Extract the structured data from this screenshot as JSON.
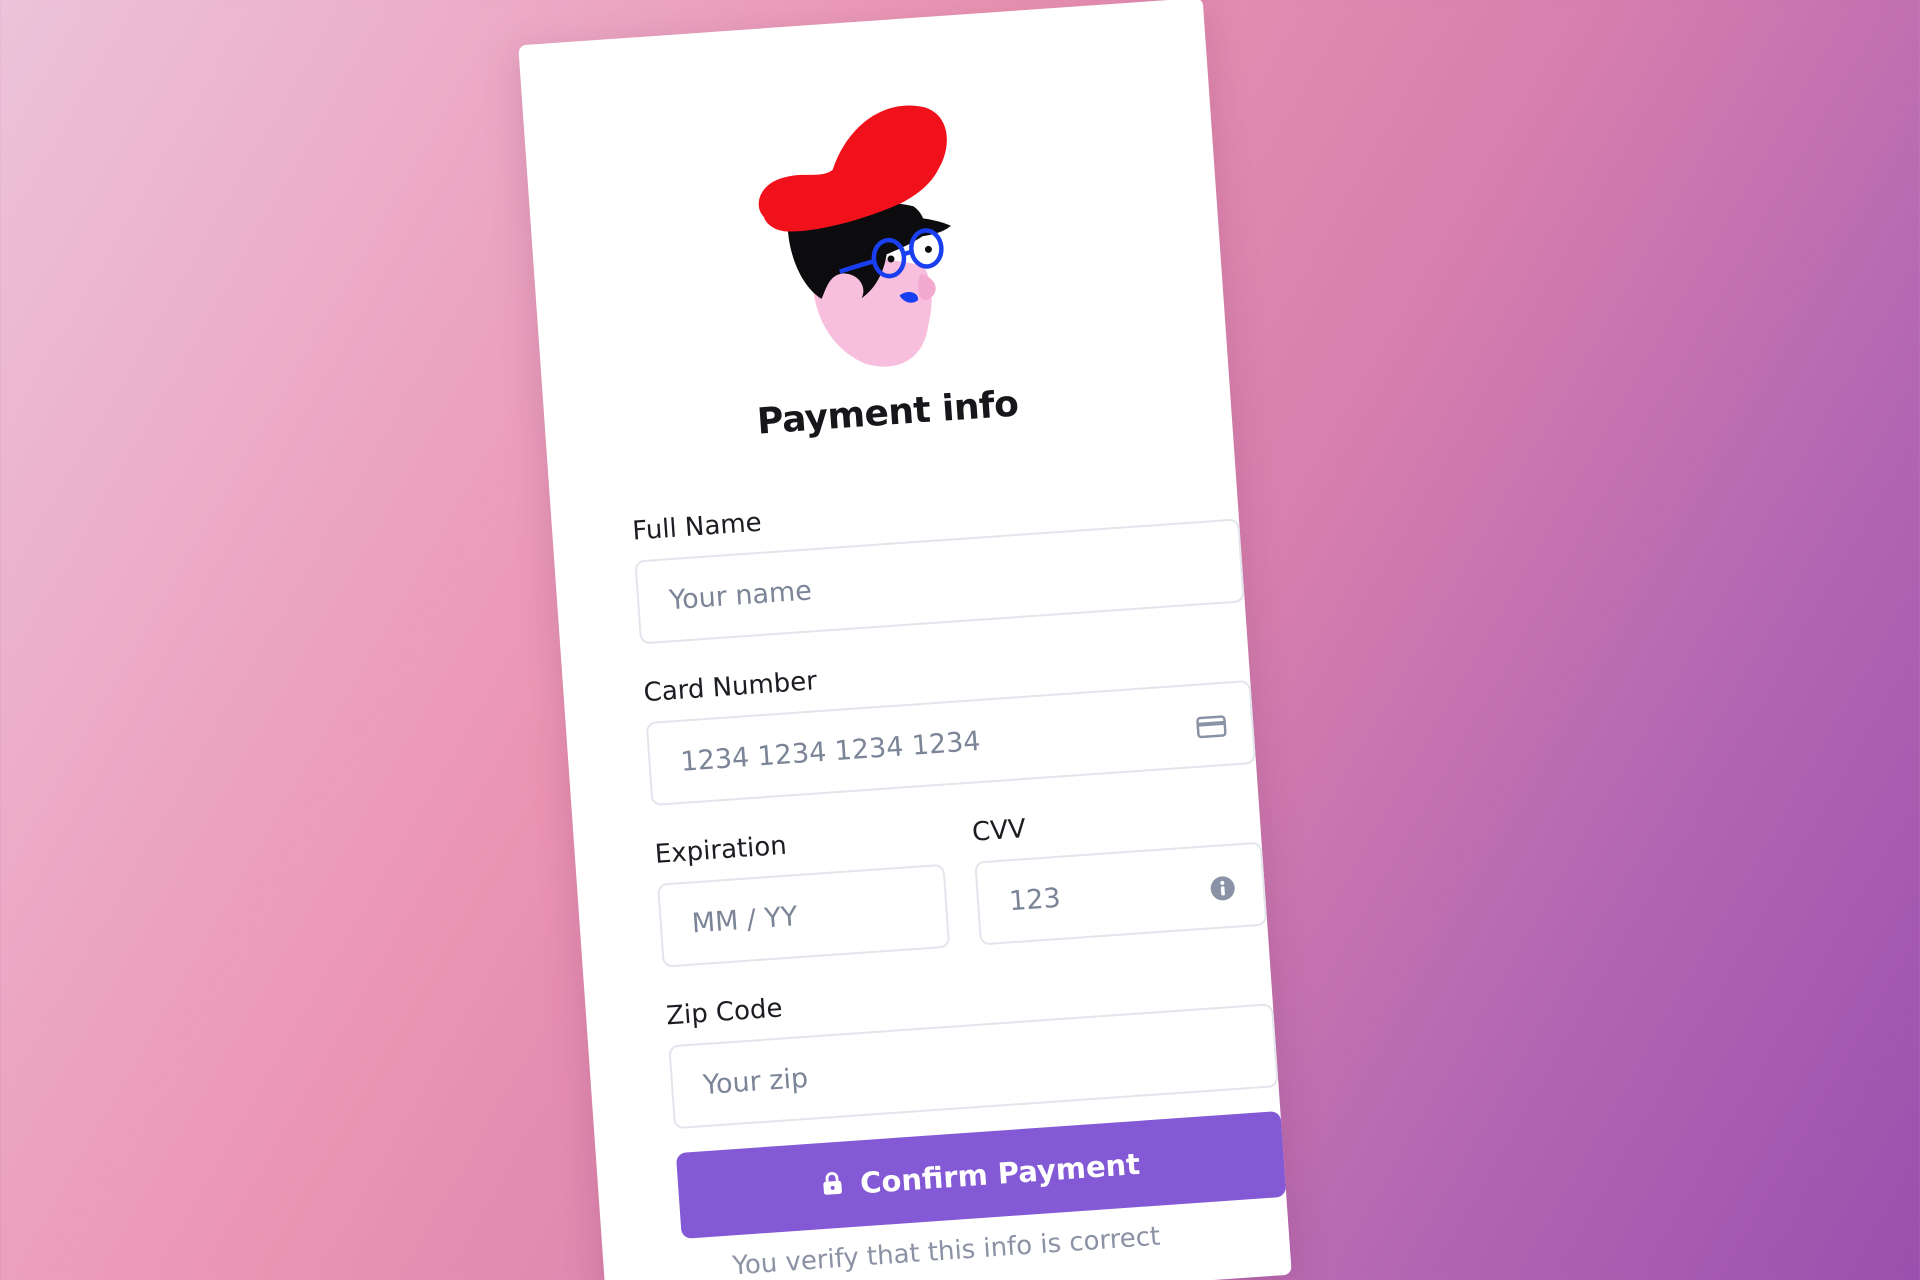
{
  "title": "Payment info",
  "fields": {
    "full_name": {
      "label": "Full Name",
      "placeholder": "Your name"
    },
    "card_number": {
      "label": "Card Number",
      "placeholder": "1234 1234 1234 1234",
      "icon": "credit-card-icon"
    },
    "expiration": {
      "label": "Expiration",
      "placeholder": "MM / YY"
    },
    "cvv": {
      "label": "CVV",
      "placeholder": "123",
      "icon": "info-icon"
    },
    "zip": {
      "label": "Zip Code",
      "placeholder": "Your zip"
    }
  },
  "confirm_button": {
    "label": "Confirm Payment",
    "icon": "lock-icon"
  },
  "verify_note": "You verify that this info is correct",
  "colors": {
    "accent": "#8459d5",
    "hat": "#f0111a",
    "glasses": "#1a3ff0",
    "skin": "#f7bede"
  }
}
